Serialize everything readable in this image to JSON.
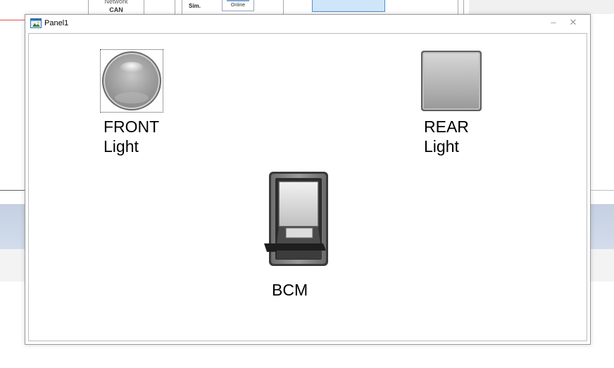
{
  "background": {
    "network_label": "Network",
    "network_type": "CAN",
    "sim_label": "Sim.",
    "online_label": "Online"
  },
  "window": {
    "title": "Panel1",
    "minimize_glyph": "–",
    "close_glyph": "✕"
  },
  "controls": {
    "front_light": {
      "line1": "FRONT",
      "line2": "Light",
      "icon": "round-lamp-icon",
      "state": "off"
    },
    "rear_light": {
      "line1": "REAR",
      "line2": "Light",
      "icon": "square-lamp-icon",
      "state": "off"
    },
    "bcm": {
      "label": "BCM",
      "icon": "rocker-switch-icon",
      "state": "off"
    }
  },
  "colors": {
    "lamp_gray": "#9c9c9c",
    "window_border": "#9a9a9a",
    "band": "#c5d0e2"
  }
}
